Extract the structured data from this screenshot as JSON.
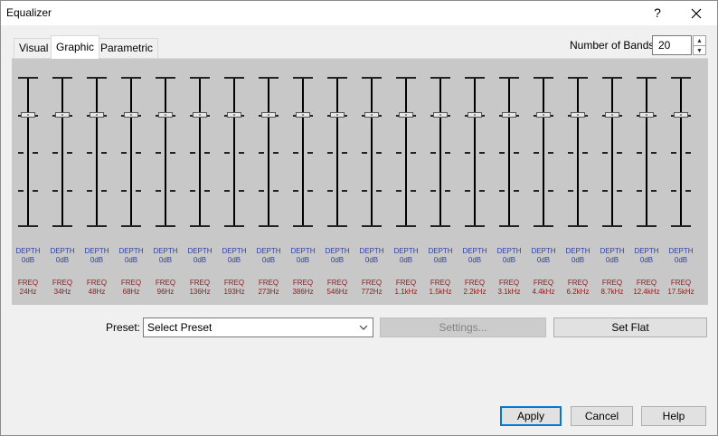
{
  "window": {
    "title": "Equalizer",
    "help_glyph": "?",
    "close_glyph": "✕"
  },
  "tabs": [
    {
      "label": "Visual",
      "active": false
    },
    {
      "label": "Graphic",
      "active": true
    },
    {
      "label": "Parametric",
      "active": false
    }
  ],
  "num_bands": {
    "label": "Number of Bands:",
    "value": "20"
  },
  "band_labels": {
    "depth": "DEPTH",
    "freq": "FREQ"
  },
  "bands": [
    {
      "gain": "0dB",
      "freq": "24Hz"
    },
    {
      "gain": "0dB",
      "freq": "34Hz"
    },
    {
      "gain": "0dB",
      "freq": "48Hz"
    },
    {
      "gain": "0dB",
      "freq": "68Hz"
    },
    {
      "gain": "0dB",
      "freq": "96Hz"
    },
    {
      "gain": "0dB",
      "freq": "136Hz"
    },
    {
      "gain": "0dB",
      "freq": "193Hz"
    },
    {
      "gain": "0dB",
      "freq": "273Hz"
    },
    {
      "gain": "0dB",
      "freq": "386Hz"
    },
    {
      "gain": "0dB",
      "freq": "546Hz"
    },
    {
      "gain": "0dB",
      "freq": "772Hz"
    },
    {
      "gain": "0dB",
      "freq": "1.1kHz"
    },
    {
      "gain": "0dB",
      "freq": "1.5kHz"
    },
    {
      "gain": "0dB",
      "freq": "2.2kHz"
    },
    {
      "gain": "0dB",
      "freq": "3.1kHz"
    },
    {
      "gain": "0dB",
      "freq": "4.4kHz"
    },
    {
      "gain": "0dB",
      "freq": "6.2kHz"
    },
    {
      "gain": "0dB",
      "freq": "8.7kHz"
    },
    {
      "gain": "0dB",
      "freq": "12.4kHz"
    },
    {
      "gain": "0dB",
      "freq": "17.5kHz"
    }
  ],
  "slider_level": 0.75,
  "preset": {
    "label": "Preset:",
    "value": "Select Preset"
  },
  "buttons": {
    "settings": "Settings...",
    "set_flat": "Set Flat",
    "apply": "Apply",
    "cancel": "Cancel",
    "help": "Help"
  },
  "colors": {
    "depth_text": "#2d3fa3",
    "freq_text": "#8a2020",
    "panel_bg": "#c8c8c8",
    "default_border": "#0078d7"
  }
}
